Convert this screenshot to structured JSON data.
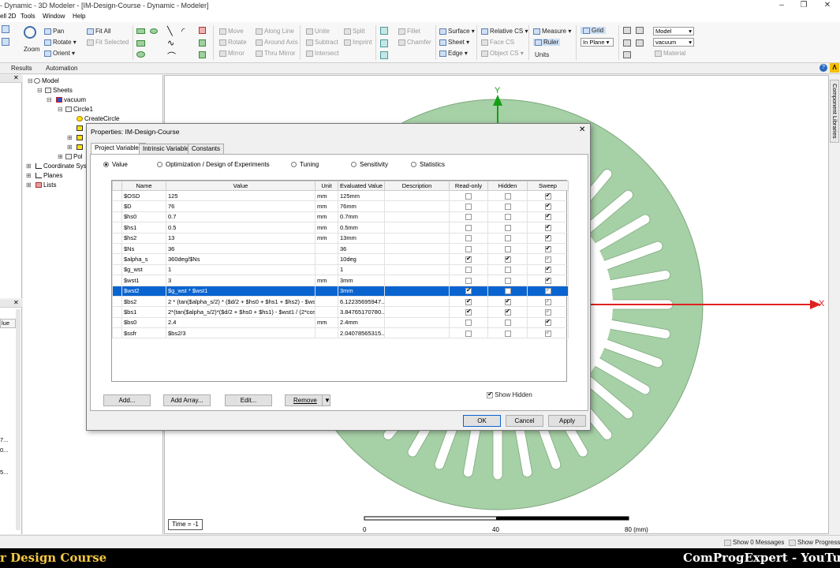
{
  "window": {
    "title": "- Dynamic - 3D Modeler - [IM-Design-Course - Dynamic - Modeler]"
  },
  "menu": [
    "ell 2D",
    "Tools",
    "Window",
    "Help"
  ],
  "ribbon": {
    "zoom": "Zoom",
    "pan": "Pan",
    "rotate": "Rotate",
    "orient": "Orient",
    "fit_all": "Fit All",
    "fit_selected": "Fit Selected",
    "move": "Move",
    "rotate2": "Rotate",
    "mirror": "Mirror",
    "along_line": "Along Line",
    "around_axis": "Around Axis",
    "thru_mirror": "Thru Mirror",
    "unite": "Unite",
    "subtract": "Subtract",
    "intersect": "Intersect",
    "split": "Split",
    "imprint": "Imprint",
    "fillet": "Fillet",
    "chamfer": "Chamfer",
    "surface": "Surface",
    "sheet": "Sheet",
    "edge": "Edge",
    "relative_cs": "Relative CS",
    "face_cs": "Face CS",
    "object_cs": "Object CS",
    "measure": "Measure",
    "ruler": "Ruler",
    "units": "Units",
    "grid": "Grid",
    "in_plane": "In Plane",
    "model_select": "Model",
    "material_select": "vacuum",
    "material": "Material"
  },
  "tabs": [
    "Results",
    "Automation"
  ],
  "tree": {
    "items": [
      "Model",
      "Sheets",
      "vacuum",
      "Circle1",
      "CreateCircle",
      "Pol",
      "Coordinate Sys",
      "Planes",
      "Lists"
    ]
  },
  "left_panel": {
    "header": "lue",
    "values": [
      "7...",
      "0...",
      "5..."
    ]
  },
  "viewport": {
    "axis_y": "Y",
    "axis_x": "X",
    "time_label": "Time = -1",
    "scale_0": "0",
    "scale_40": "40",
    "scale_80": "80 (mm)",
    "side_tab": "Component Libraries"
  },
  "dialog": {
    "title": "Properties: IM-Design-Course",
    "tabs": [
      "Project Variables",
      "Intrinsic Variables",
      "Constants"
    ],
    "radios": [
      "Value",
      "Optimization / Design of Experiments",
      "Tuning",
      "Sensitivity",
      "Statistics"
    ],
    "columns": [
      "Name",
      "Value",
      "Unit",
      "Evaluated Value",
      "Description",
      "Read-only",
      "Hidden",
      "Sweep"
    ],
    "rows": [
      {
        "name": "$OSD",
        "value": "125",
        "unit": "mm",
        "eval": "125mm",
        "desc": "",
        "ro": false,
        "hid": false,
        "sw": true,
        "swdim": false
      },
      {
        "name": "$D",
        "value": "76",
        "unit": "mm",
        "eval": "76mm",
        "desc": "",
        "ro": false,
        "hid": false,
        "sw": true,
        "swdim": false
      },
      {
        "name": "$hs0",
        "value": "0.7",
        "unit": "mm",
        "eval": "0.7mm",
        "desc": "",
        "ro": false,
        "hid": false,
        "sw": true,
        "swdim": false
      },
      {
        "name": "$hs1",
        "value": "0.5",
        "unit": "mm",
        "eval": "0.5mm",
        "desc": "",
        "ro": false,
        "hid": false,
        "sw": true,
        "swdim": false
      },
      {
        "name": "$hs2",
        "value": "13",
        "unit": "mm",
        "eval": "13mm",
        "desc": "",
        "ro": false,
        "hid": false,
        "sw": true,
        "swdim": false
      },
      {
        "name": "$Ns",
        "value": "36",
        "unit": "",
        "eval": "36",
        "desc": "",
        "ro": false,
        "hid": false,
        "sw": true,
        "swdim": false
      },
      {
        "name": "$alpha_s",
        "value": "360deg/$Ns",
        "unit": "",
        "eval": "10deg",
        "desc": "",
        "ro": true,
        "hid": true,
        "sw": true,
        "swdim": true
      },
      {
        "name": "$g_wst",
        "value": "1",
        "unit": "",
        "eval": "1",
        "desc": "",
        "ro": false,
        "hid": false,
        "sw": true,
        "swdim": false
      },
      {
        "name": "$wst1",
        "value": "3",
        "unit": "mm",
        "eval": "3mm",
        "desc": "",
        "ro": false,
        "hid": false,
        "sw": true,
        "swdim": false
      },
      {
        "name": "$wst2",
        "value": "$g_wst * $wst1",
        "unit": "",
        "eval": "3mm",
        "desc": "",
        "ro": true,
        "hid": false,
        "sw": true,
        "swdim": true
      },
      {
        "name": "$bs2",
        "value": "2 * (tan($alpha_s/2) * ($d/2 + $hs0 + $hs1 + $hs2) - $wst...",
        "unit": "",
        "eval": "6.12235695947...",
        "desc": "",
        "ro": true,
        "hid": true,
        "sw": true,
        "swdim": true
      },
      {
        "name": "$bs1",
        "value": "2*(tan($alpha_s/2)*($d/2 + $hs0 + $hs1) - $wst1 / (2*cos...",
        "unit": "",
        "eval": "3.84765170780...",
        "desc": "",
        "ro": true,
        "hid": true,
        "sw": true,
        "swdim": true
      },
      {
        "name": "$bs0",
        "value": "2.4",
        "unit": "mm",
        "eval": "2.4mm",
        "desc": "",
        "ro": false,
        "hid": false,
        "sw": true,
        "swdim": false
      },
      {
        "name": "$ssfr",
        "value": "$bs2/3",
        "unit": "",
        "eval": "2.04078565315...",
        "desc": "",
        "ro": false,
        "hid": false,
        "sw": true,
        "swdim": true
      }
    ],
    "show_hidden": "Show Hidden",
    "buttons": {
      "add": "Add...",
      "add_array": "Add Array...",
      "edit": "Edit...",
      "remove": "Remove",
      "ok": "OK",
      "cancel": "Cancel",
      "apply": "Apply"
    }
  },
  "status": {
    "messages": "Show 0 Messages",
    "progress": "Show Progress"
  },
  "banner": {
    "left": "r Design Course",
    "right": "ComProgExpert - YouTube"
  }
}
